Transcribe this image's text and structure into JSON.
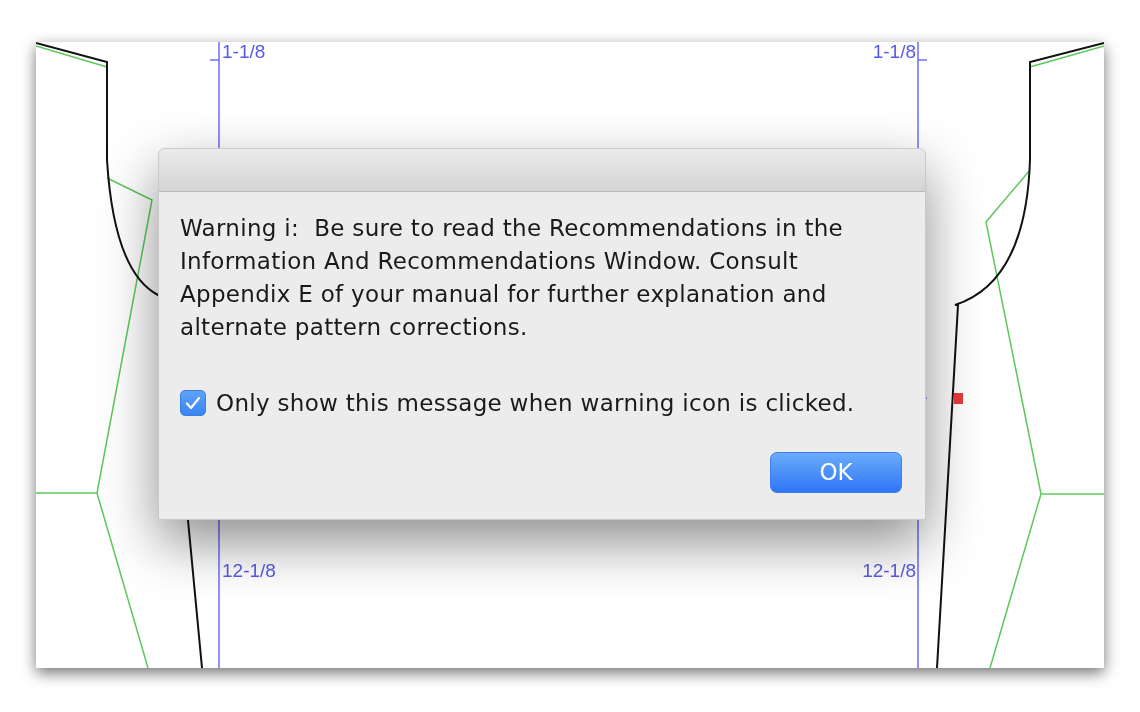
{
  "canvas": {
    "top_labels": [
      "1-1/8",
      "1-1/8"
    ],
    "bottom_labels": [
      "12-1/8",
      "12-1/8"
    ]
  },
  "dialog": {
    "message": "Warning i:  Be sure to read the Recommendations in the Information And Recommendations Window. Consult Appendix E of your manual for further explanation and alternate pattern corrections.",
    "checkbox": {
      "label": "Only show this message when warning icon is clicked.",
      "checked": true
    },
    "buttons": [
      {
        "label": "OK",
        "default": true
      }
    ]
  }
}
